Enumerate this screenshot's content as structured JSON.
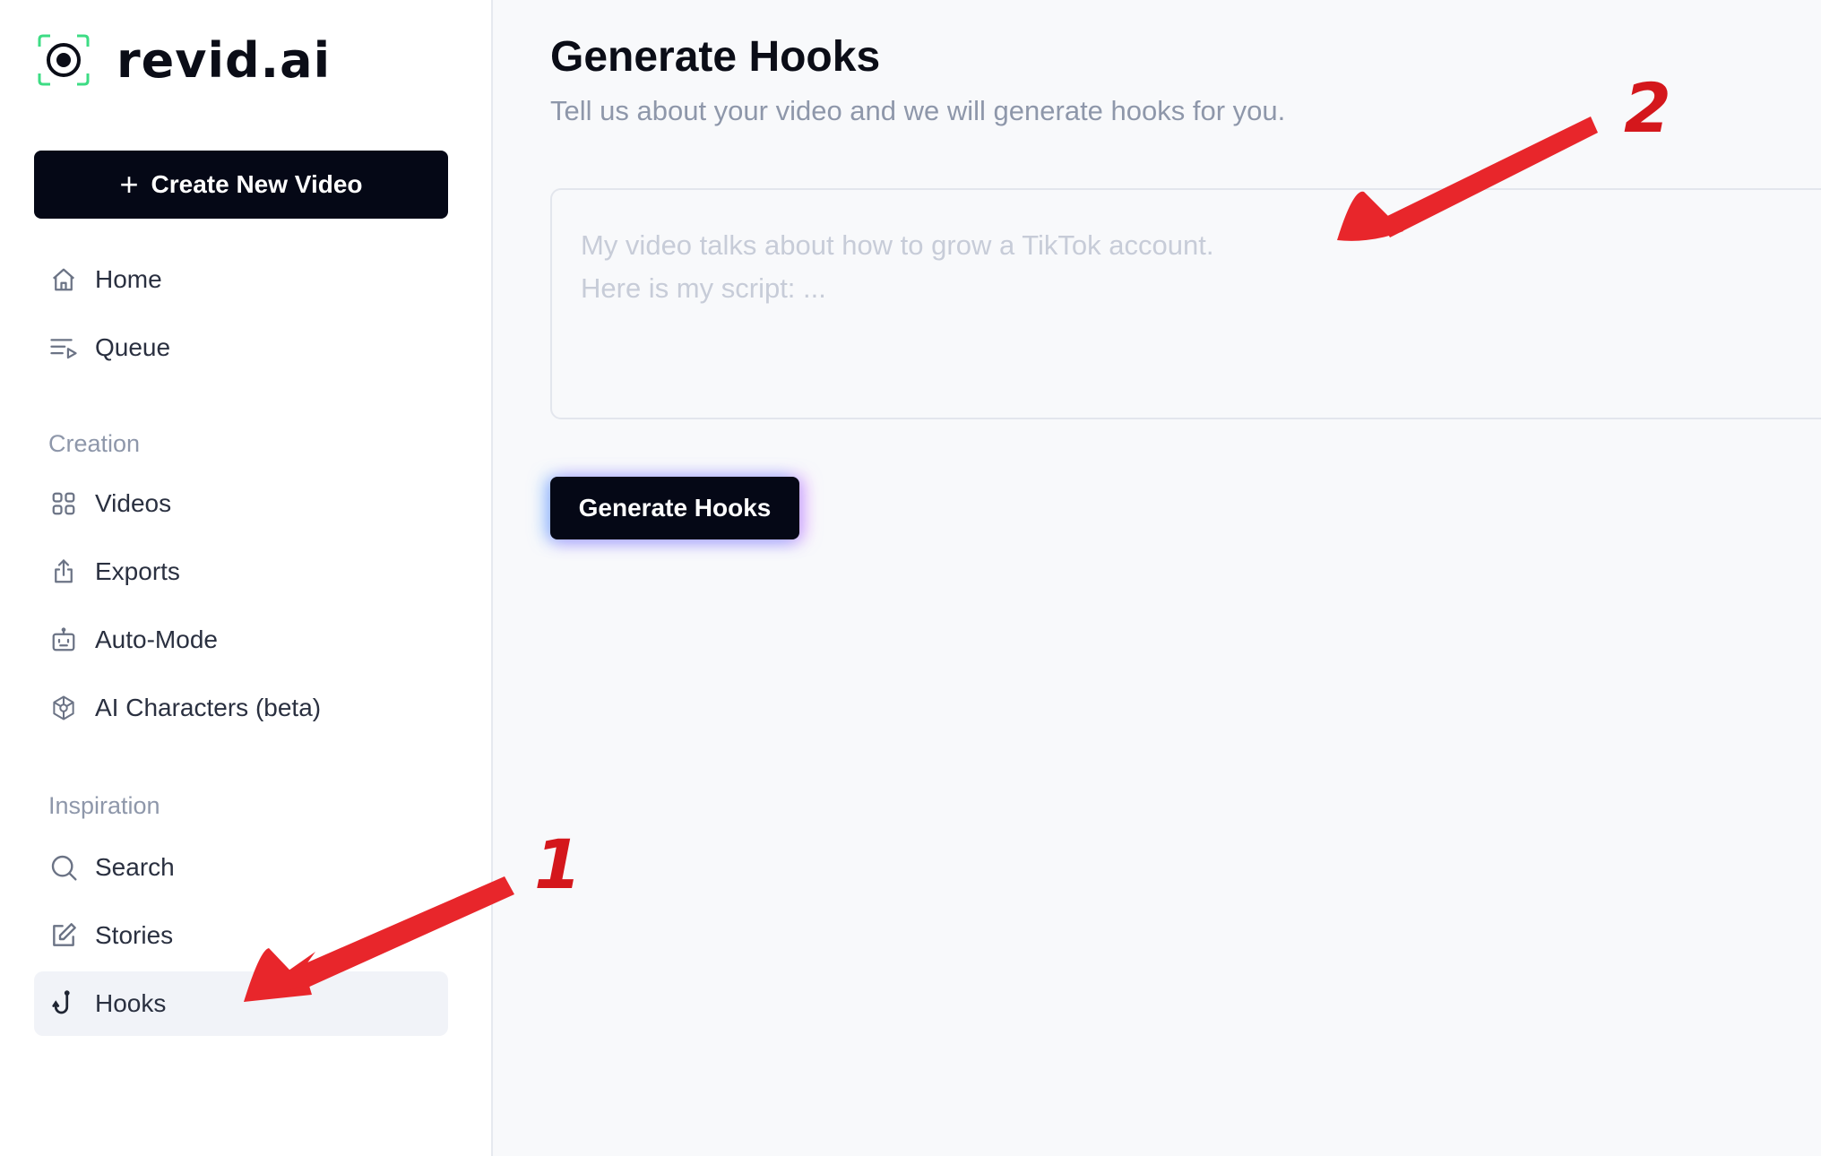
{
  "brand": {
    "name": "revid.ai",
    "accent": "#3ddc84"
  },
  "sidebar": {
    "create_button": "Create New Video",
    "top_items": [
      {
        "label": "Home",
        "icon": "home-icon"
      },
      {
        "label": "Queue",
        "icon": "queue-icon"
      }
    ],
    "sections": [
      {
        "label": "Creation",
        "items": [
          {
            "label": "Videos",
            "icon": "grid-icon"
          },
          {
            "label": "Exports",
            "icon": "export-icon"
          },
          {
            "label": "Auto-Mode",
            "icon": "robot-icon"
          },
          {
            "label": "AI Characters (beta)",
            "icon": "ai-chip-icon"
          }
        ]
      },
      {
        "label": "Inspiration",
        "items": [
          {
            "label": "Search",
            "icon": "search-icon"
          },
          {
            "label": "Stories",
            "icon": "edit-icon"
          },
          {
            "label": "Hooks",
            "icon": "hook-icon",
            "active": true
          }
        ]
      }
    ]
  },
  "main": {
    "title": "Generate Hooks",
    "subtitle": "Tell us about your video and we will generate hooks for you.",
    "textarea_placeholder": "My video talks about how to grow a TikTok account.\nHere is my script: ...",
    "textarea_value": "",
    "generate_button": "Generate Hooks"
  },
  "annotations": {
    "callout_1": "1",
    "callout_2": "2",
    "arrow_color": "#e8262b"
  }
}
